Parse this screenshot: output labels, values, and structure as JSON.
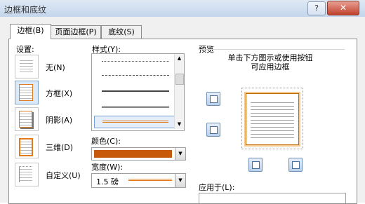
{
  "window": {
    "title": "边框和底纹",
    "help_label": "?",
    "close_label": "✕"
  },
  "tabs": [
    {
      "label": "边框(B)",
      "active": true
    },
    {
      "label": "页面边框(P)",
      "active": false
    },
    {
      "label": "底纹(S)",
      "active": false
    }
  ],
  "settings": {
    "label": "设置:",
    "items": [
      {
        "label": "无(N)",
        "selected": false
      },
      {
        "label": "方框(X)",
        "selected": true
      },
      {
        "label": "阴影(A)",
        "selected": false
      },
      {
        "label": "三维(D)",
        "selected": false
      },
      {
        "label": "自定义(U)",
        "selected": false
      }
    ]
  },
  "style": {
    "label": "样式(Y):",
    "selected_index": 4
  },
  "color": {
    "label": "颜色(C):",
    "value": "#c65a0a"
  },
  "width": {
    "label": "宽度(W):",
    "value": "1.5 磅"
  },
  "preview": {
    "label": "预览",
    "hint": "单击下方图示或使用按钮可应用边框",
    "apply_label": "应用于(L):"
  },
  "accent_color": "#e07a1a"
}
